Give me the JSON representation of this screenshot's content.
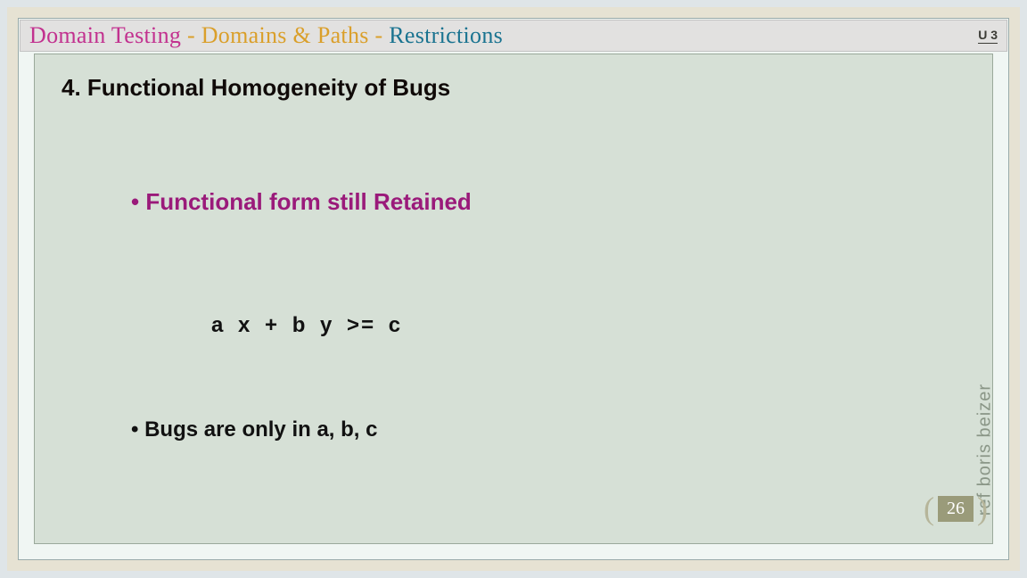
{
  "header": {
    "title_part1": "Domain Testing ",
    "title_part2": "- Domains & Paths - ",
    "title_part3": "Restrictions",
    "unit": "U 3"
  },
  "content": {
    "section_heading": "4. Functional Homogeneity of Bugs",
    "bullet1": "•  Functional form still Retained",
    "formula": "a x + b y >=   c",
    "bullet2": "•  Bugs are only in a, b, c"
  },
  "side_reference": "ref boris beizer",
  "page_number": "26"
}
